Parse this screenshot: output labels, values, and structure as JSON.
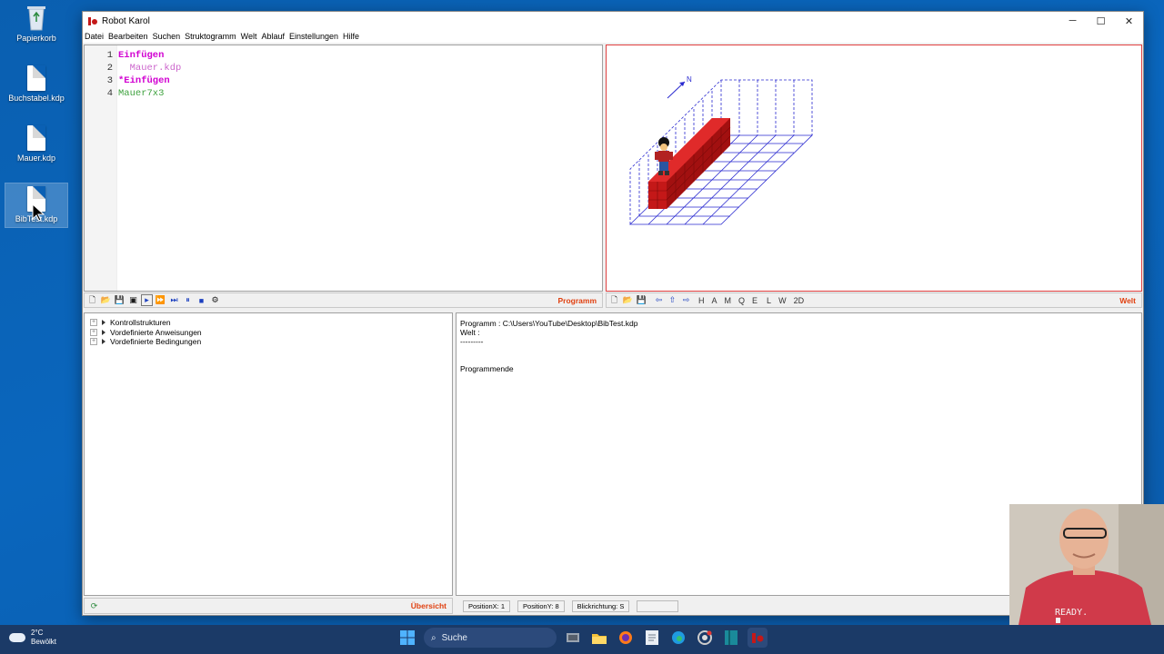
{
  "desktop": {
    "icons": [
      {
        "label": "Papierkorb",
        "icon": "recycle-bin-icon"
      },
      {
        "label": "Buchstabel.kdp",
        "icon": "document-icon"
      },
      {
        "label": "Mauer.kdp",
        "icon": "document-icon"
      },
      {
        "label": "BibTest.kdp",
        "icon": "document-icon"
      }
    ]
  },
  "window": {
    "title": "Robot Karol",
    "controls": {
      "minimize": "─",
      "maximize": "☐",
      "close": "✕"
    }
  },
  "menu": [
    "Datei",
    "Bearbeiten",
    "Suchen",
    "Struktogramm",
    "Welt",
    "Ablauf",
    "Einstellungen",
    "Hilfe"
  ],
  "editor": {
    "lines": [
      {
        "num": "1",
        "text": "Einfügen",
        "style": "kw"
      },
      {
        "num": "2",
        "text": "  Mauer.kdp",
        "style": "str"
      },
      {
        "num": "3",
        "text": "*Einfügen",
        "style": "kw"
      },
      {
        "num": "4",
        "text": "Mauer7x3",
        "style": "grn"
      }
    ],
    "panel_label": "Programm"
  },
  "world": {
    "compass_label": "N",
    "panel_label": "Welt",
    "letter_buttons": [
      "H",
      "A",
      "M",
      "Q",
      "E",
      "L",
      "W",
      "2D"
    ],
    "colors": {
      "grid": "#2a2ad0",
      "brick": "#c41818",
      "frame": "#e04040"
    }
  },
  "tree": {
    "items": [
      "Kontrollstrukturen",
      "Vordefinierte Anweisungen",
      "Vordefinierte Bedingungen"
    ],
    "panel_label": "Übersicht"
  },
  "output": {
    "lines": [
      "Programm : C:\\Users\\YouTube\\Desktop\\BibTest.kdp",
      "Welt :",
      "---------",
      "",
      "",
      "Programmende"
    ]
  },
  "status": {
    "position_x": "PositionX: 1",
    "position_y": "PositionY: 8",
    "direction": "Blickrichtung: S",
    "extra": ""
  },
  "taskbar": {
    "weather_temp": "2°C",
    "weather_desc": "Bewölkt",
    "search_label": "Suche"
  },
  "webcam": {
    "shirt_text": "READY."
  }
}
